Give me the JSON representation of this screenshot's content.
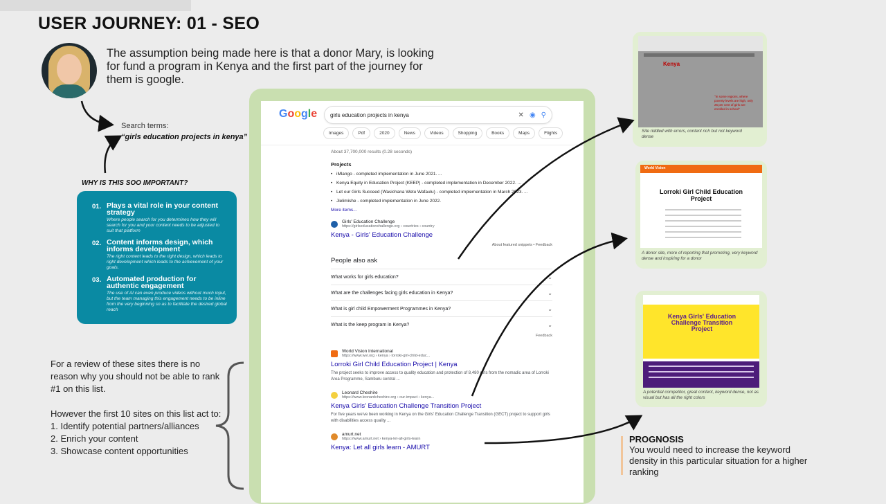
{
  "title": "USER JOURNEY: 01 - SEO",
  "assumption": "The assumption being made here is that a donor Mary, is looking for fund a program in Kenya and the first part of the journey for them is google.",
  "search": {
    "label": "Search terms:",
    "quote": "“girls education projects in kenya”"
  },
  "why_heading": "WHY IS THIS SOO IMPORTANT?",
  "reasons": [
    {
      "num": "01.",
      "head": "Plays a vital role in your content strategy",
      "desc": "Where people search for you determines how they will search for you and your content needs to be adjusted to suit that platform"
    },
    {
      "num": "02.",
      "head": "Content informs design, which informs development",
      "desc": "The right content leads to the right design, which leads to right development which leads to the achievement of your goals."
    },
    {
      "num": "03.",
      "head": "Automated production for authentic engagement",
      "desc": "The use of AI can even produce videos without much input, but the team managing this engagement needs to be inline from the very beginning so as to facilitate the desired global reach"
    }
  ],
  "review": {
    "p1": "For a review of these sites there is no reason why you should not be able to rank #1 on this list.",
    "p2_intro": "However the first 10 sites on this list act to:",
    "list": [
      "1. Identify potential partners/alliances",
      "2. Enrich your content",
      "3. Showcase content opportunities"
    ]
  },
  "serp": {
    "logo": "Google",
    "query": "girls education projects in kenya",
    "chips": [
      "Images",
      "Pdf",
      "2020",
      "News",
      "Videos",
      "Shopping",
      "Books",
      "Maps",
      "Flights"
    ],
    "results_count": "About 37,700,000 results (0.28 seconds)",
    "projects_heading": "Projects",
    "projects": [
      "iMlango - completed implementation in June 2021. ...",
      "Kenya Equity in Education Project (KEEP) - completed implementation in December 2022. ...",
      "Let our Girls Succeed (Wasichana Wetu Wafaulu) - completed implementation in March 2023. ...",
      "Jielimishe - completed implementation in June 2022."
    ],
    "more_items": "More items...",
    "featured": {
      "site": "Girls' Education Challenge",
      "url": "https://girlseducationchallenge.org › countries › country",
      "title": "Kenya - Girls' Education Challenge"
    },
    "about_snippets": "About featured snippets  •  Feedback",
    "paa_heading": "People also ask",
    "paa": [
      "What works for girls education?",
      "What are the challenges facing girls education in Kenya?",
      "What is girl child Empowerment Programmes in Kenya?",
      "What is the keep program in Kenya?"
    ],
    "feedback": "Feedback",
    "results": [
      {
        "site": "World Vision International",
        "url": "https://www.wvi.org › kenya › lorroki-girl-child-educ...",
        "title": "Lorroki Girl Child Education Project | Kenya",
        "desc": "The project seeks to improve access to quality education and protection of 8,480 girls from the nomadic area of Lorroki Area Programme, Samburu central ..."
      },
      {
        "site": "Leonard Cheshire",
        "url": "https://www.leonardcheshire.org › our-impact › kenya...",
        "title": "Kenya Girls' Education Challenge Transition Project",
        "desc": "For five years we've been working in Kenya on the Girls' Education Challenge Transition (GECT) project to support girls with disabilities access quality ..."
      },
      {
        "site": "amurt.net",
        "url": "https://www.amurt.net › kenya-let-all-girls-learn",
        "title": "Kenya: Let all girls learn - AMURT",
        "desc": ""
      }
    ]
  },
  "thumbs": {
    "t1": {
      "heading": "Kenya",
      "red_text": "\"In some regions, where poverty levels are high, only 25 per cent of girls are enrolled in school\"",
      "caption": "Site riddled with errors, content rich but not keyword dense"
    },
    "t2": {
      "logo": "World Vision",
      "heading": "Lorroki Girl Child Education Project",
      "caption": "A donor site, more of reporting that promoting, very keyword dense and inspiring for a donor"
    },
    "t3": {
      "heading": "Kenya Girls' Education Challenge Transition Project",
      "caption": "A potential competitor, great content, keyword dense, not as visual but has all the right colors"
    }
  },
  "prognosis": {
    "heading": "PROGNOSIS",
    "body": "You would need to increase the keyword density in this particular situation for a higher ranking"
  }
}
